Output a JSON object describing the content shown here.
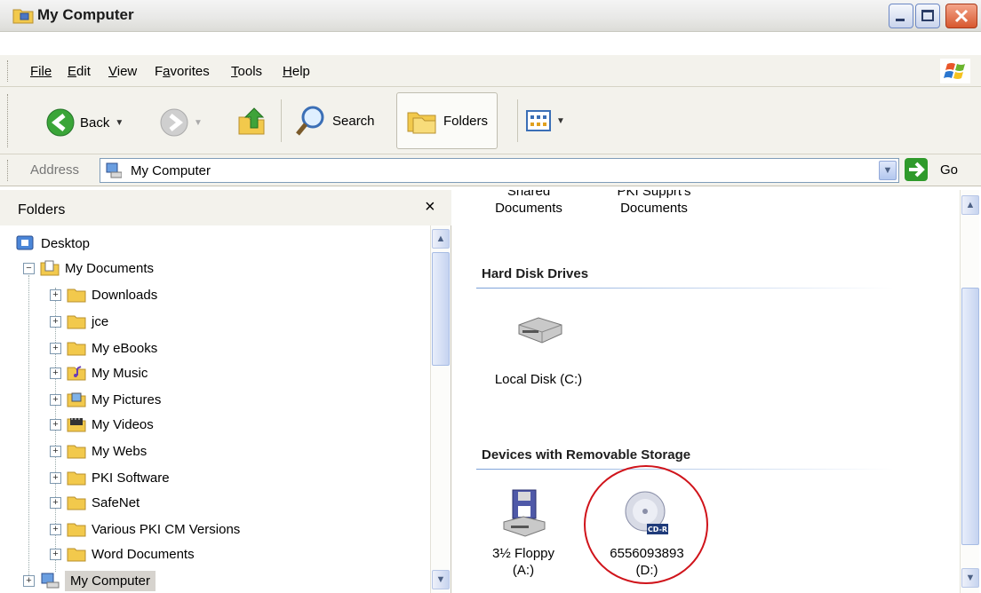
{
  "window": {
    "title": "My Computer"
  },
  "menu": [
    "File",
    "Edit",
    "View",
    "Favorites",
    "Tools",
    "Help"
  ],
  "menu_mnemonics": [
    0,
    0,
    0,
    1,
    0,
    0
  ],
  "toolbar": {
    "back_label": "Back",
    "search_label": "Search",
    "folders_label": "Folders"
  },
  "address": {
    "label": "Address",
    "value": "My Computer",
    "go_label": "Go"
  },
  "folders_pane": {
    "title": "Folders",
    "close_glyph": "×",
    "tree": [
      {
        "label": "Desktop"
      },
      {
        "label": "My Documents"
      },
      {
        "label": "Downloads"
      },
      {
        "label": "jce"
      },
      {
        "label": "My eBooks"
      },
      {
        "label": "My Music"
      },
      {
        "label": "My Pictures"
      },
      {
        "label": "My Videos"
      },
      {
        "label": "My Webs"
      },
      {
        "label": "PKI Software"
      },
      {
        "label": "SafeNet"
      },
      {
        "label": "Various PKI CM Versions"
      },
      {
        "label": "Word Documents"
      },
      {
        "label": "My Computer"
      }
    ]
  },
  "main": {
    "partial_items": [
      {
        "line1": "Shared",
        "line2": "Documents"
      },
      {
        "line1": "PKI Supprt's",
        "line2": "Documents"
      }
    ],
    "groups": [
      {
        "header": "Hard Disk Drives",
        "items": [
          {
            "label": "Local Disk (C:)"
          }
        ]
      },
      {
        "header": "Devices with Removable Storage",
        "items": [
          {
            "line1": "3½ Floppy",
            "line2": "(A:)"
          },
          {
            "line1": "6556093893",
            "line2": "(D:)"
          }
        ]
      }
    ],
    "cd_badge": "CD-R"
  },
  "colors": {
    "highlight_circle": "#d0141b",
    "selection": "#d6d3ce",
    "go": "#2f9a2b"
  }
}
